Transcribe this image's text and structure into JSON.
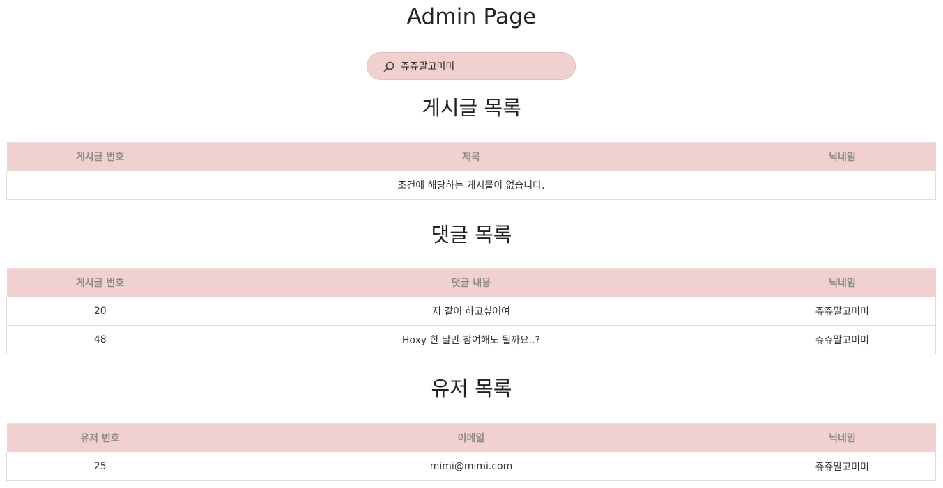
{
  "header": {
    "title": "Admin Page"
  },
  "search": {
    "value": "쥬쥬말고미미",
    "icon": "search-icon"
  },
  "posts": {
    "title": "게시글 목록",
    "columns": [
      "게시글 번호",
      "제목",
      "닉네임"
    ],
    "empty_message": "조건에 해당하는 게시물이 없습니다."
  },
  "comments": {
    "title": "댓글 목록",
    "columns": [
      "게시글 번호",
      "댓글 내용",
      "닉네임"
    ],
    "rows": [
      {
        "post_no": "20",
        "content": "저 같이 하고싶어여",
        "nickname": "쥬쥬말고미미"
      },
      {
        "post_no": "48",
        "content": "Hoxy 한 달만 참여해도 될까요..?",
        "nickname": "쥬쥬말고미미"
      }
    ]
  },
  "users": {
    "title": "유저 목록",
    "columns": [
      "유저 번호",
      "이메일",
      "닉네임"
    ],
    "rows": [
      {
        "user_no": "25",
        "email": "mimi@mimi.com",
        "nickname": "쥬쥬말고미미"
      }
    ]
  },
  "colors": {
    "accent": "#f0d1d0",
    "header_text": "#8a8a8a"
  }
}
